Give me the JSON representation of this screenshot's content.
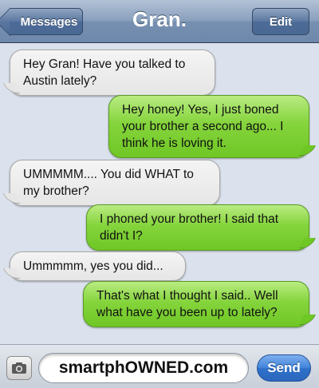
{
  "header": {
    "back_label": "Messages",
    "title": "Gran.",
    "edit_label": "Edit"
  },
  "messages": [
    {
      "direction": "incoming",
      "text": "Hey Gran! Have you talked to Austin lately?"
    },
    {
      "direction": "outgoing",
      "text": "Hey honey! Yes, I just boned your brother a second ago... I think he is loving it."
    },
    {
      "direction": "incoming",
      "text": "UMMMMM.... You did WHAT to my brother?"
    },
    {
      "direction": "outgoing",
      "text": "I phoned your brother! I said that didn't I?"
    },
    {
      "direction": "incoming",
      "text": "Ummmmm, yes you did..."
    },
    {
      "direction": "outgoing",
      "text": "That's what I thought I said.. Well what have you been up to lately?"
    }
  ],
  "composer": {
    "camera_icon": "camera-icon",
    "field_text": "smartphOWNED.com",
    "send_label": "Send"
  },
  "colors": {
    "incoming_bubble": "#e6e6e6",
    "outgoing_bubble": "#85d43c",
    "nav_bar": "#7790b1",
    "send_button": "#3f82d9",
    "background": "#dbe2ed"
  }
}
